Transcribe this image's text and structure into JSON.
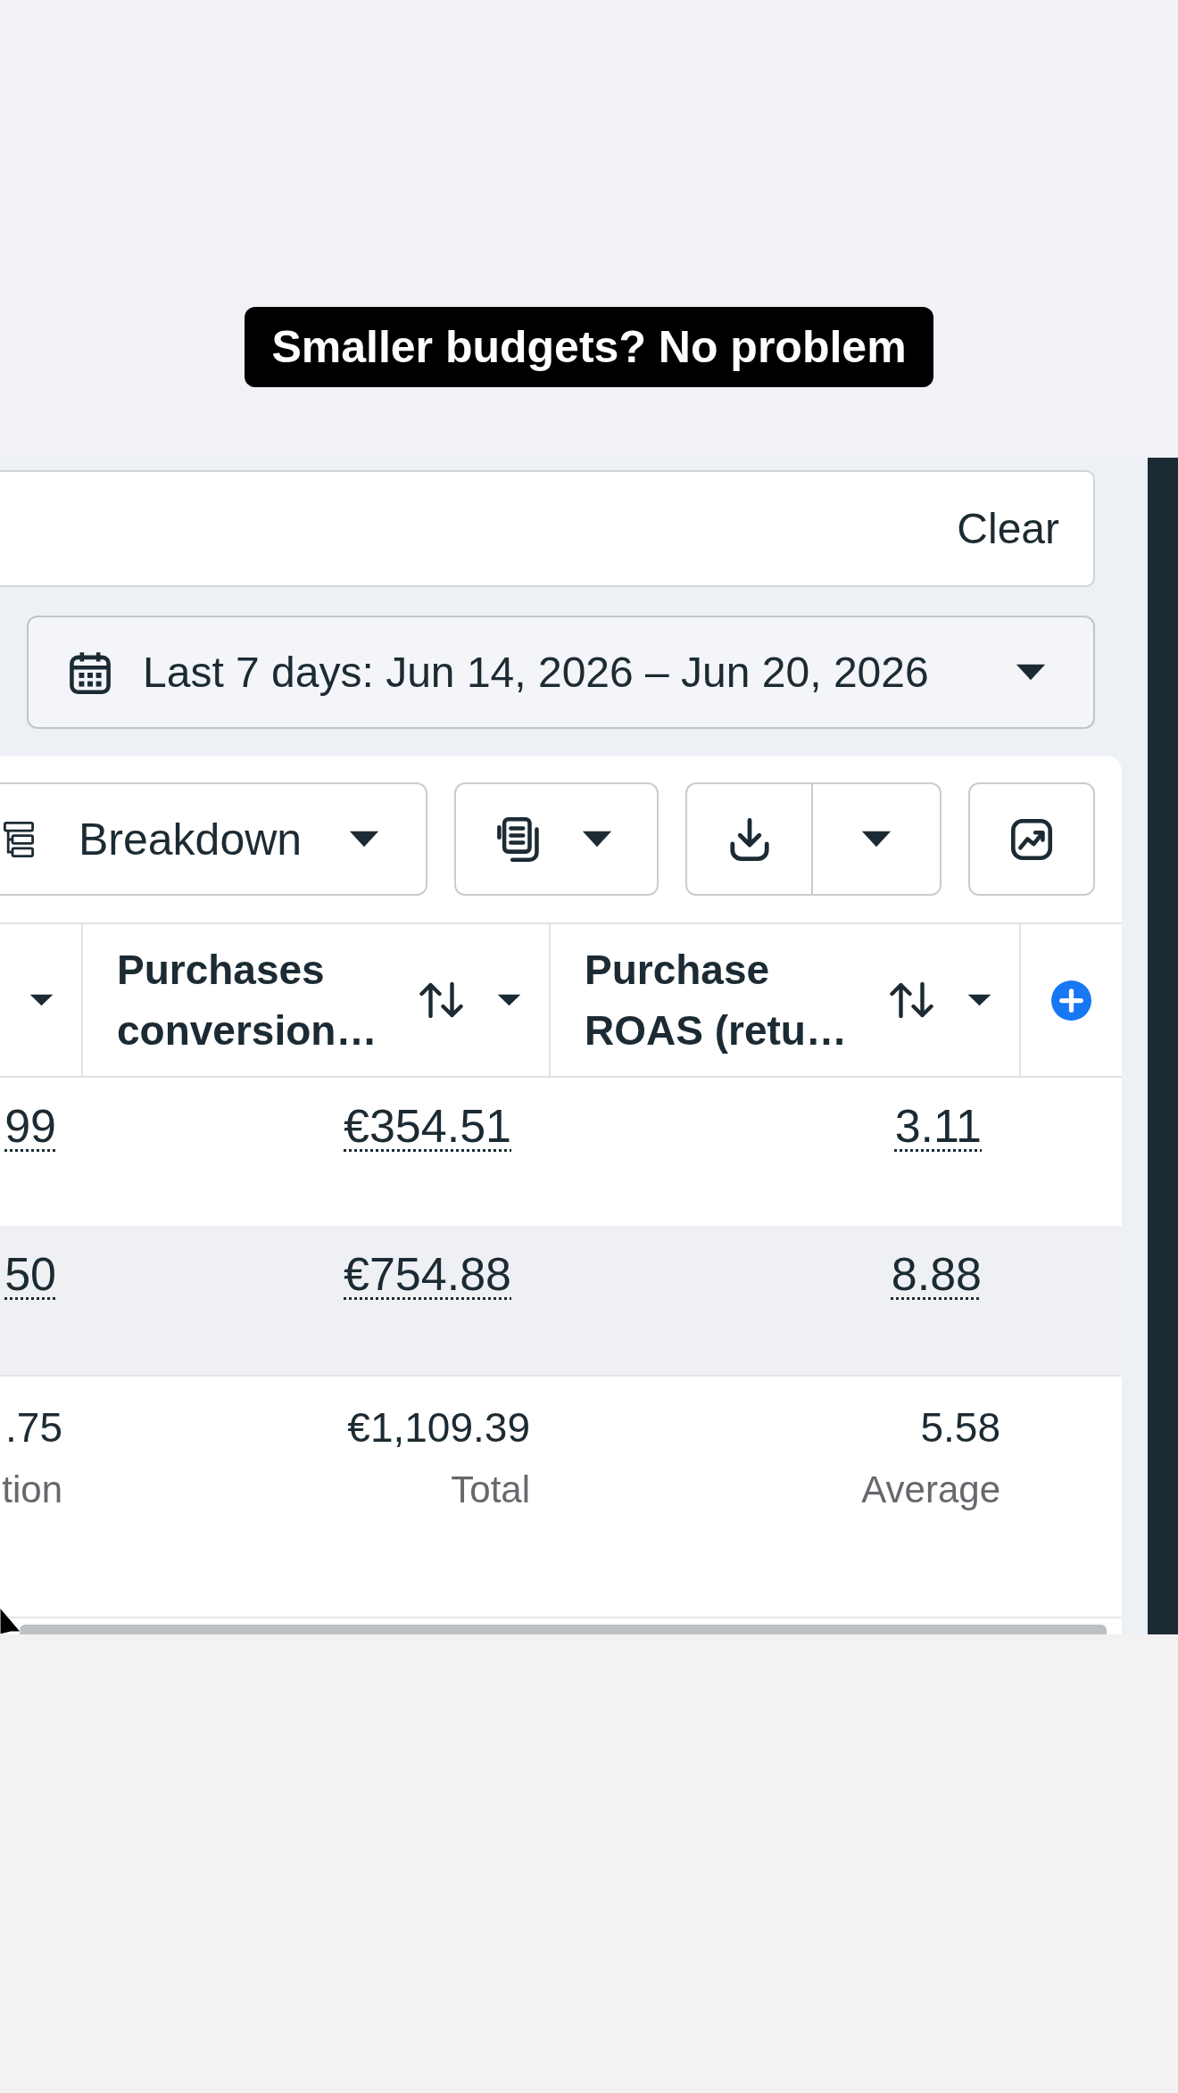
{
  "caption": {
    "text": "Smaller budgets? No problem"
  },
  "filter_bar": {
    "clear_label": "Clear"
  },
  "date_range": {
    "label": "Last 7 days: Jun 14, 2026 – Jun 20, 2026"
  },
  "toolbar": [
    {
      "kind": "breakdown",
      "label": "Breakdown"
    },
    {
      "kind": "columns"
    },
    {
      "kind": "export"
    },
    {
      "kind": "chart"
    }
  ],
  "table": {
    "columns": [
      {
        "kind": "cut_off"
      },
      {
        "kind": "metric",
        "label": "Purchases conversion…"
      },
      {
        "kind": "metric",
        "label": "Purchase ROAS (retu…"
      },
      {
        "kind": "add"
      }
    ],
    "rows": [
      {
        "hovered": false,
        "cells": [
          "99",
          "€354.51",
          "3.11"
        ]
      },
      {
        "hovered": true,
        "cells": [
          "50",
          "€754.88",
          "8.88"
        ]
      }
    ],
    "totals": [
      {
        "value": ".75",
        "label": "tion"
      },
      {
        "value": "€1,109.39",
        "label": "Total"
      },
      {
        "value": "5.58",
        "label": "Average"
      }
    ]
  }
}
